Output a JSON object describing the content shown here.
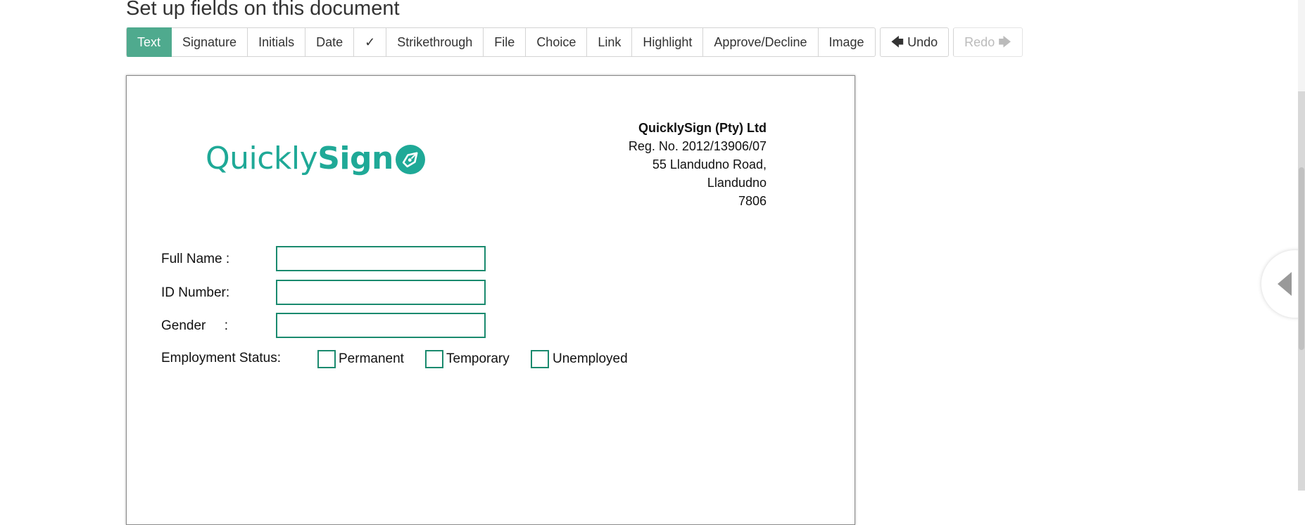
{
  "page": {
    "title": "Set up fields on this document"
  },
  "toolbar": {
    "field_types": [
      {
        "label": "Text",
        "active": true
      },
      {
        "label": "Signature"
      },
      {
        "label": "Initials"
      },
      {
        "label": "Date"
      },
      {
        "label": "✓"
      },
      {
        "label": "Strikethrough"
      },
      {
        "label": "File"
      },
      {
        "label": "Choice"
      },
      {
        "label": "Link"
      },
      {
        "label": "Highlight"
      },
      {
        "label": "Approve/Decline"
      },
      {
        "label": "Image"
      }
    ],
    "undo_label": "Undo",
    "redo_label": "Redo",
    "undo_icon": "arrow-left-icon",
    "redo_icon": "arrow-right-icon"
  },
  "document": {
    "logo": {
      "text_light": "Quickly",
      "text_bold": "Sign",
      "icon": "pen-nib-icon",
      "color": "#1fa997"
    },
    "company": {
      "name": "QuicklySign (Pty) Ltd",
      "reg_no": "Reg. No. 2012/13906/07",
      "address_line1": "55 Llandudno Road,",
      "address_line2": "Llandudno",
      "postal_code": "7806"
    },
    "form": {
      "full_name_label": "Full Name :",
      "id_number_label": "ID Number:",
      "gender_label": "Gender     :",
      "employment_status_label": "Employment Status:",
      "options": [
        "Permanent",
        "Temporary",
        "Unemployed"
      ]
    }
  },
  "colors": {
    "accent": "#4faa8e",
    "field_border": "#1a8a6e"
  }
}
